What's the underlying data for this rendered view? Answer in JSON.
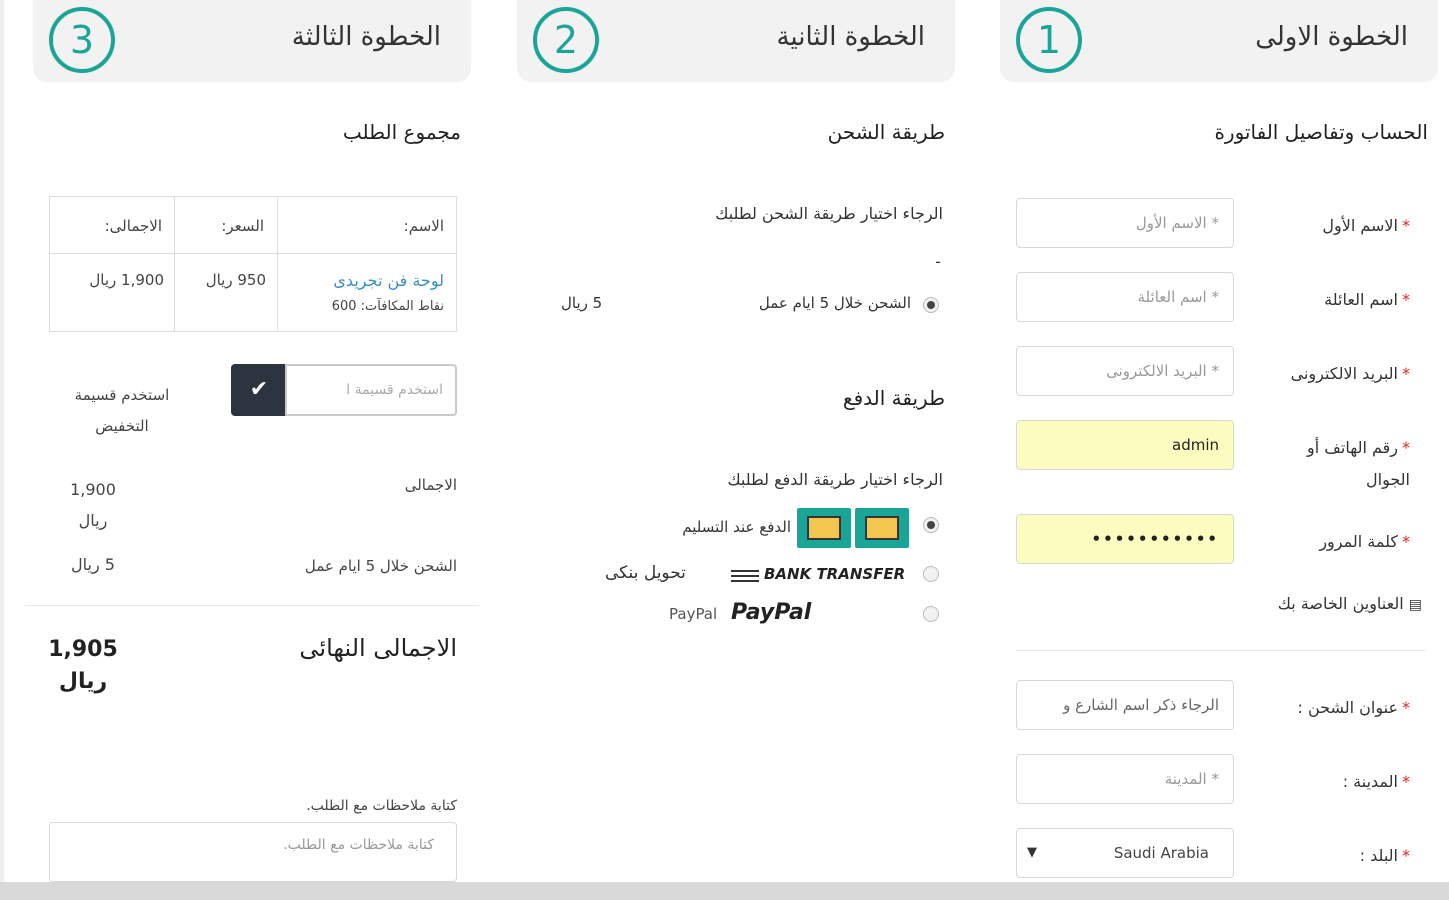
{
  "steps": [
    {
      "number": "1",
      "title": "الخطوة الاولى"
    },
    {
      "number": "2",
      "title": "الخطوة الثانية"
    },
    {
      "number": "3",
      "title": "الخطوة الثالثة"
    }
  ],
  "account": {
    "title": "الحساب وتفاصيل الفاتورة",
    "fields": [
      {
        "label": "الاسم الأول",
        "placeholder": "* الاسم الأول",
        "value": ""
      },
      {
        "label": "اسم العائلة",
        "placeholder": "* اسم العائلة",
        "value": ""
      },
      {
        "label": "البريد الالكترونى",
        "placeholder": "* البريد الالكترونى",
        "value": ""
      },
      {
        "label": "رقم الهاتف أو الجوال",
        "placeholder": "",
        "value": "admin"
      },
      {
        "label": "كلمة المرور",
        "placeholder": "",
        "value": "•••••••••••"
      }
    ],
    "addresses_link": "العناوين الخاصة بك",
    "shipping_address": {
      "label": "عنوان الشحن :",
      "placeholder": "الرجاء ذكر اسم الشارع و"
    },
    "city": {
      "label": "المدينة :",
      "placeholder": "* المدينة"
    },
    "country": {
      "label": "البلد :",
      "value": "Saudi Arabia"
    }
  },
  "shipping": {
    "title": "طريقة الشحن",
    "instruction": "الرجاء اختيار طريقة الشحن لطلبك",
    "dash": "-",
    "option_label": "الشحن خلال 5 ايام عمل",
    "option_price": "5 ريال"
  },
  "payment": {
    "title": "طريقة الدفع",
    "instruction": "الرجاء اختيار طريقة الدفع لطلبك",
    "options": [
      {
        "label": "الدفع عند التسليم"
      },
      {
        "brand": "BANK TRANSFER",
        "label": "تحويل بنكى"
      },
      {
        "brand": "PayPal",
        "label": "PayPal"
      }
    ]
  },
  "summary": {
    "title": "مجموع الطلب",
    "headers": {
      "name": "الاسم:",
      "price": "السعر:",
      "total": "الاجمالى:"
    },
    "item": {
      "name": "لوحة فن تجريدى",
      "points": "نقاط المكافآت: 600",
      "price": "950 ريال",
      "total": "1,900 ريال"
    },
    "coupon_placeholder": "استخدم قسيمة ا",
    "coupon_label": "استخدم قسيمة التخفيض",
    "subtotal_label": "الاجمالى",
    "subtotal_value": "1,900 ريال",
    "shipping_label": "الشحن خلال 5 ايام عمل",
    "shipping_value": "5 ريال",
    "grand_label": "الاجمالى النهائى",
    "grand_value": "1,905 ريال",
    "notes_label": "كتابة ملاحظات مع الطلب.",
    "notes_placeholder": "كتابة ملاحظات مع الطلب."
  },
  "colors": {
    "accent": "#1aa597",
    "autofill": "#fbfcbf",
    "link": "#3a8fc8",
    "required": "#e32222"
  }
}
